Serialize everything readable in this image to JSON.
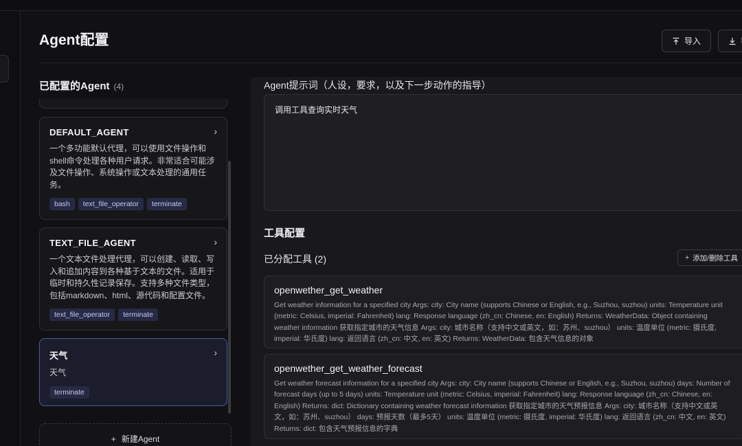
{
  "header": {
    "title": "Agent配置",
    "import_label": "导入",
    "export_label": "导"
  },
  "agent_list": {
    "title": "已配置的Agent",
    "count": "(4)",
    "agents": [
      {
        "name": "DEFAULT_AGENT",
        "description": "一个多功能默认代理，可以使用文件操作和shell命令处理各种用户请求。非常适合可能涉及文件操作、系统操作或文本处理的通用任务。",
        "tags": [
          "bash",
          "text_file_operator",
          "terminate"
        ]
      },
      {
        "name": "TEXT_FILE_AGENT",
        "description": "一个文本文件处理代理，可以创建、读取、写入和追加内容到各种基于文本的文件。适用于临时和持久性记录保存。支持多种文件类型，包括markdown、html、源代码和配置文件。",
        "tags": [
          "text_file_operator",
          "terminate"
        ]
      },
      {
        "name": "天气",
        "description": "天气",
        "tags": [
          "terminate"
        ]
      }
    ],
    "new_agent_label": "新建Agent"
  },
  "detail": {
    "prompt_label": "Agent提示词（人设，要求，以及下一步动作的指导）",
    "prompt_value": "调用工具查询实时天气",
    "tools_title": "工具配置",
    "assigned_label": "已分配工具 (2)",
    "add_remove_label": "添加/删除工具",
    "tools": [
      {
        "name": "openwether_get_weather",
        "description": "Get weather information for a specified city Args: city: City name (supports Chinese or English, e.g., Suzhou, suzhou) units: Temperature unit (metric: Celsius, imperial: Fahrenheit) lang: Response language (zh_cn: Chinese, en: English) Returns: WeatherData: Object containing weather information 获取指定城市的天气信息 Args: city: 城市名称（支持中文或英文，如：苏州、suzhou） units: 温度单位 (metric: 摄氏度, imperial: 华氏度) lang: 返回语言 (zh_cn: 中文, en: 英文) Returns: WeatherData: 包含天气信息的对象"
      },
      {
        "name": "openwether_get_weather_forecast",
        "description": "Get weather forecast information for a specified city Args: city: City name (supports Chinese or English, e.g., Suzhou, suzhou) days: Number of forecast days (up to 5 days) units: Temperature unit (metric: Celsius, imperial: Fahrenheit) lang: Response language (zh_cn: Chinese, en: English) Returns: dict: Dictionary containing weather forecast information 获取指定城市的天气预报信息 Args: city: 城市名称（支持中文或英文，如：苏州、suzhou） days: 预报天数（最多5天） units: 温度单位 (metric: 摄氏度, imperial: 华氏度) lang: 返回语言 (zh_cn: 中文, en: 英文) Returns: dict: 包含天气预报信息的字典"
      }
    ]
  }
}
